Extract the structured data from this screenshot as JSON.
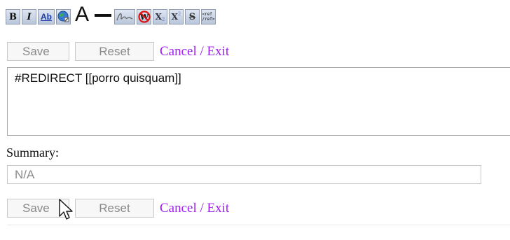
{
  "toolbar": {
    "buttons": [
      {
        "icon": "bold-icon",
        "label": "B"
      },
      {
        "icon": "italic-icon",
        "label": "I"
      },
      {
        "icon": "internal-link-icon",
        "label": "Ab"
      },
      {
        "icon": "external-link-icon"
      },
      {
        "icon": "headline-icon",
        "label": "A"
      },
      {
        "icon": "horizontal-line-icon"
      },
      {
        "icon": "signature-icon"
      },
      {
        "icon": "nowiki-icon"
      },
      {
        "icon": "subscript-icon",
        "label": "X"
      },
      {
        "icon": "superscript-icon",
        "label": "X"
      },
      {
        "icon": "strikethrough-icon",
        "label": "S"
      },
      {
        "icon": "reference-icon",
        "label": "<ref\n/ref>"
      }
    ]
  },
  "actions_top": {
    "save_label": "Save",
    "reset_label": "Reset",
    "cancel_label": "Cancel / Exit"
  },
  "editor": {
    "content": "#REDIRECT [[porro quisquam]]"
  },
  "summary": {
    "label": "Summary:",
    "value": "N/A"
  },
  "actions_bottom": {
    "save_label": "Save",
    "reset_label": "Reset",
    "cancel_label": "Cancel / Exit"
  },
  "colors": {
    "link": "#a020f0",
    "toolbar_button": "#c9d3e4"
  }
}
